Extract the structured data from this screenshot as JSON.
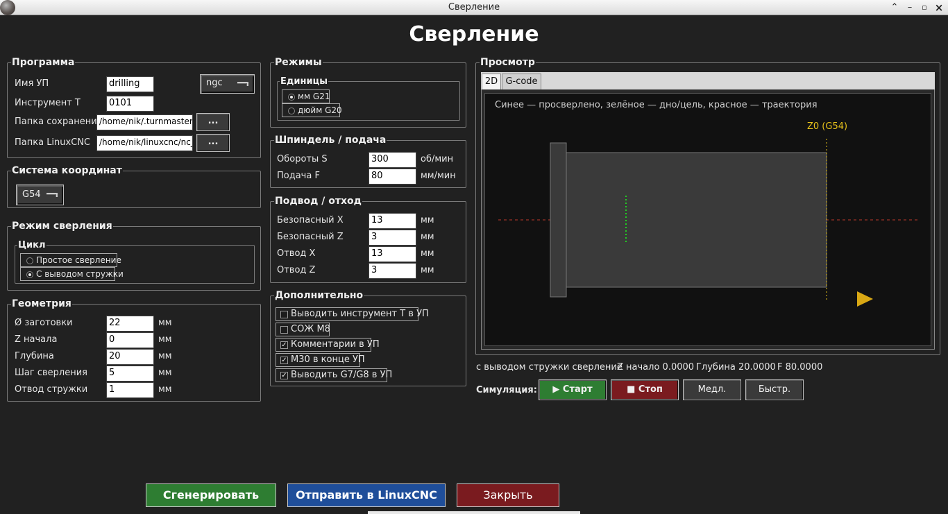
{
  "window": {
    "title": "Сверление"
  },
  "heading": "Сверление",
  "program": {
    "group_label": "Программа",
    "name_label": "Имя УП",
    "name_value": "drilling",
    "ext_value": "ngc",
    "tool_label": "Инструмент T",
    "tool_value": "0101",
    "save_dir_label": "Папка сохранения",
    "save_dir_value": "/home/nik/.turnmaster/ge",
    "linuxcnc_dir_label": "Папка LinuxCNC",
    "linuxcnc_dir_value": "/home/nik/linuxcnc/nc_fil",
    "browse_label": "..."
  },
  "coords": {
    "group_label": "Система координат",
    "value": "G54"
  },
  "drill_mode": {
    "group_label": "Режим сверления",
    "cycle_label": "Цикл",
    "options": [
      "Простое сверление",
      "С выводом стружки"
    ],
    "selected": 1
  },
  "geometry": {
    "group_label": "Геометрия",
    "rows": [
      {
        "label": "Ø заготовки",
        "value": "22",
        "unit": "мм"
      },
      {
        "label": "Z начала",
        "value": "0",
        "unit": "мм"
      },
      {
        "label": "Глубина",
        "value": "20",
        "unit": "мм"
      },
      {
        "label": "Шаг сверления",
        "value": "5",
        "unit": "мм"
      },
      {
        "label": "Отвод стружки",
        "value": "1",
        "unit": "мм"
      }
    ]
  },
  "modes": {
    "group_label": "Режимы",
    "units_label": "Единицы",
    "units_options": [
      "мм G21",
      "дюйм G20"
    ],
    "units_selected": 0
  },
  "spindle": {
    "group_label": "Шпиндель / подача",
    "rows": [
      {
        "label": "Обороты S",
        "value": "300",
        "unit": "об/мин"
      },
      {
        "label": "Подача F",
        "value": "80",
        "unit": "мм/мин"
      }
    ]
  },
  "approach": {
    "group_label": "Подвод / отход",
    "rows": [
      {
        "label": "Безопасный X",
        "value": "13",
        "unit": "мм"
      },
      {
        "label": "Безопасный Z",
        "value": "3",
        "unit": "мм"
      },
      {
        "label": "Отвод X",
        "value": "13",
        "unit": "мм"
      },
      {
        "label": "Отвод Z",
        "value": "3",
        "unit": "мм"
      }
    ]
  },
  "extra": {
    "group_label": "Дополнительно",
    "options": [
      {
        "label": "Выводить инструмент T в УП",
        "checked": false
      },
      {
        "label": "СОЖ M8",
        "checked": false
      },
      {
        "label": "Комментарии в УП",
        "checked": true
      },
      {
        "label": "M30 в конце УП",
        "checked": true
      },
      {
        "label": "Выводить G7/G8 в УП",
        "checked": true
      }
    ]
  },
  "preview": {
    "group_label": "Просмотр",
    "tabs": [
      "2D",
      "G-code"
    ],
    "active_tab": 0,
    "legend": "Синее — просверлено, зелёное — дно/цель, красное — траектория",
    "z0_label": "Z0 (G54)",
    "colors": {
      "axis": "#c0392b",
      "target": "#22cc22",
      "stock": "#3a3a3a",
      "z0": "#e8c21a",
      "tool": "#d9a814"
    }
  },
  "status": {
    "text": "с выводом стружки сверление",
    "z_start": "Z начало 0.0000",
    "depth": "Глубина 20.0000",
    "feed": "F 80.0000"
  },
  "simulation": {
    "label": "Симуляция:",
    "start": "▶ Старт",
    "stop": "■ Стоп",
    "slow": "Медл.",
    "fast": "Быстр."
  },
  "actions": {
    "generate": "Сгенерировать",
    "send": "Отправить в LinuxCNC",
    "close": "Закрыть",
    "colors": {
      "generate": "#2e7d32",
      "send": "#1f4e9a",
      "close": "#7a1b1f"
    }
  }
}
